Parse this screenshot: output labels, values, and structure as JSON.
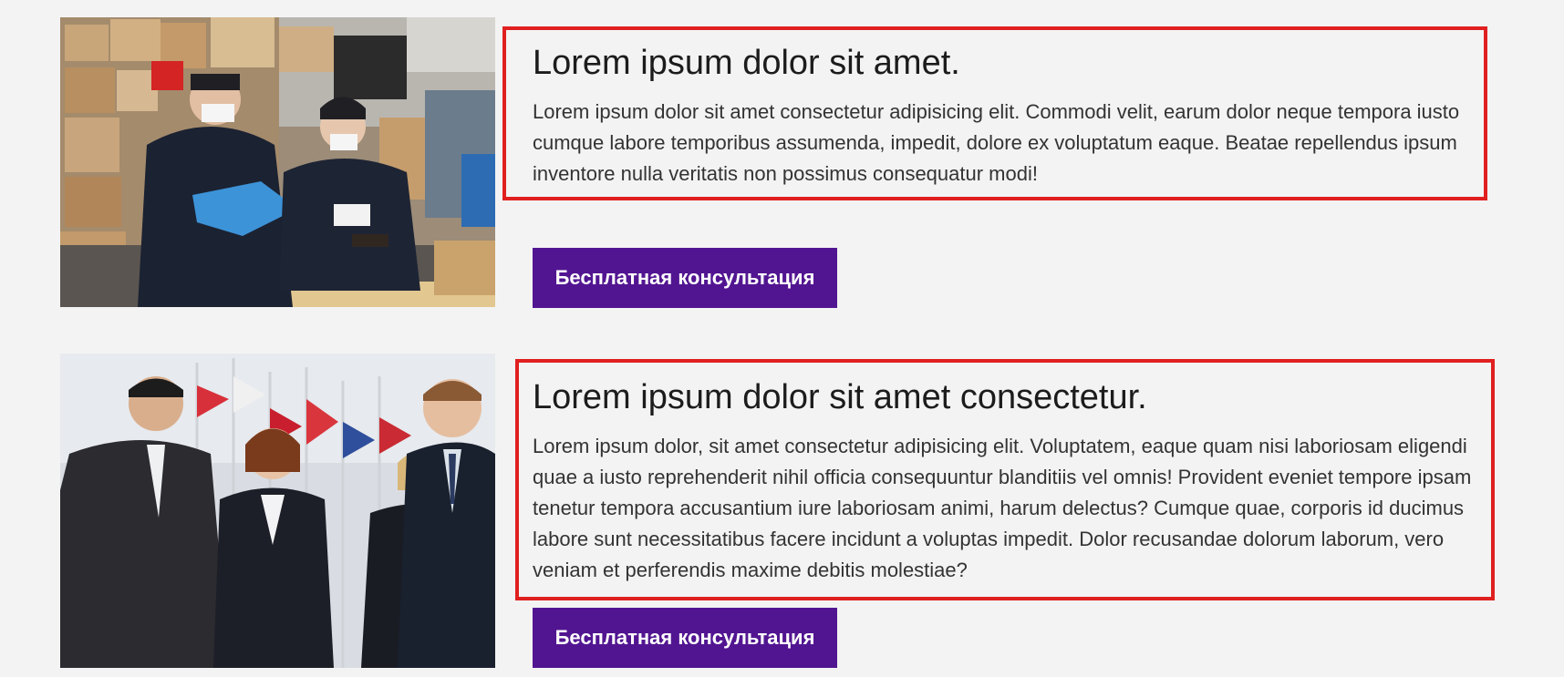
{
  "theme": {
    "accent": "#521591",
    "highlight_border": "#e02020",
    "background": "#f3f3f3"
  },
  "services": [
    {
      "image_subject": "customs-officers-inspecting-parcels",
      "title": "Lorem ipsum dolor sit amet.",
      "description": "Lorem ipsum dolor sit amet consectetur adipisicing elit. Commodi velit, earum dolor neque tempora iusto cumque labore temporibus assumenda, impedit, dolore ex voluptatum eaque. Beatae repellendus ipsum inventore nulla veritatis non possimus consequatur modi!",
      "button_label": "Бесплатная консультация"
    },
    {
      "image_subject": "business-people-talking-near-flags",
      "title": "Lorem ipsum dolor sit amet consectetur.",
      "description": "Lorem ipsum dolor, sit amet consectetur adipisicing elit. Voluptatem, eaque quam nisi laboriosam eligendi quae a iusto reprehenderit nihil officia consequuntur blanditiis vel omnis! Provident eveniet tempore ipsam tenetur tempora accusantium iure laboriosam animi, harum delectus? Cumque quae, corporis id ducimus labore sunt necessitatibus facere incidunt a voluptas impedit. Dolor recusandae dolorum laborum, vero veniam et perferendis maxime debitis molestiae?",
      "button_label": "Бесплатная консультация"
    }
  ]
}
